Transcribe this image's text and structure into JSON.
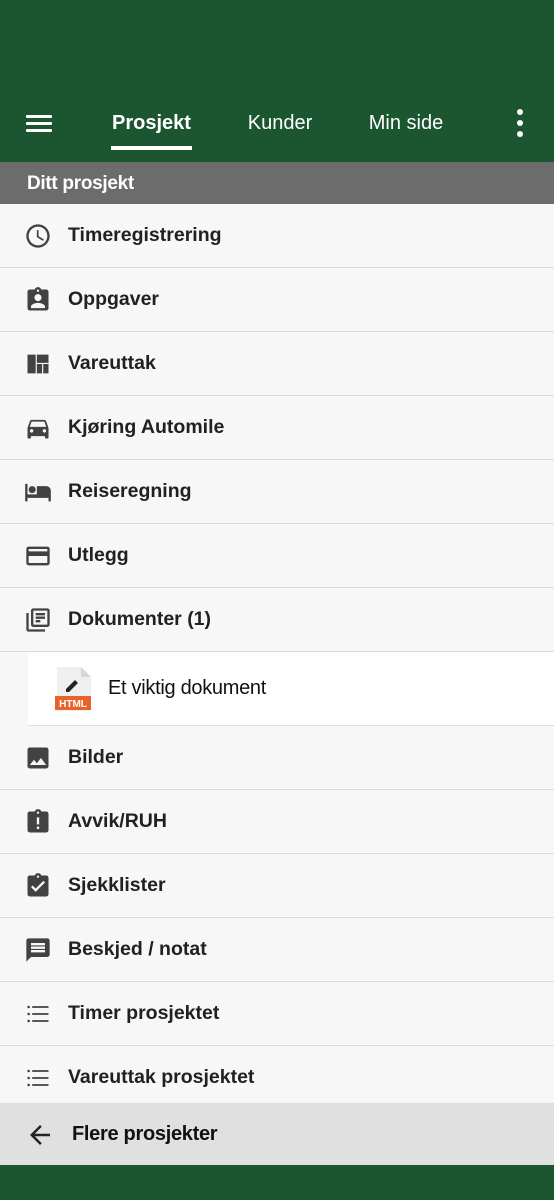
{
  "colors": {
    "app_bar": "#1b5630",
    "section_header": "#6c6c6c",
    "icon": "#424242",
    "html_badge": "#e8632b"
  },
  "nav": {
    "menu_icon": "hamburger-icon",
    "tabs": [
      {
        "label": "Prosjekt",
        "active": true
      },
      {
        "label": "Kunder",
        "active": false
      },
      {
        "label": "Min side",
        "active": false
      }
    ],
    "more_icon": "more-vert-icon"
  },
  "section": {
    "title": "Ditt prosjekt"
  },
  "items": [
    {
      "label": "Timeregistrering",
      "icon": "clock-icon"
    },
    {
      "label": "Oppgaver",
      "icon": "assignment-ind-icon"
    },
    {
      "label": "Vareuttak",
      "icon": "dashboard-icon"
    },
    {
      "label": "Kjøring Automile",
      "icon": "car-icon"
    },
    {
      "label": "Reiseregning",
      "icon": "hotel-bed-icon"
    },
    {
      "label": "Utlegg",
      "icon": "credit-card-icon"
    },
    {
      "label": "Dokumenter (1)",
      "icon": "library-books-icon"
    },
    {
      "label": "Bilder",
      "icon": "image-icon"
    },
    {
      "label": "Avvik/RUH",
      "icon": "assignment-late-icon"
    },
    {
      "label": "Sjekklister",
      "icon": "assignment-turned-in-icon"
    },
    {
      "label": "Beskjed / notat",
      "icon": "message-icon"
    },
    {
      "label": "Timer prosjektet",
      "icon": "list-icon"
    },
    {
      "label": "Vareuttak prosjektet",
      "icon": "list-icon"
    }
  ],
  "documents": [
    {
      "label": "Et viktig dokument",
      "icon": "html-file-icon",
      "badge": "HTML"
    }
  ],
  "footer": {
    "label": "Flere prosjekter",
    "icon": "arrow-back-icon"
  }
}
